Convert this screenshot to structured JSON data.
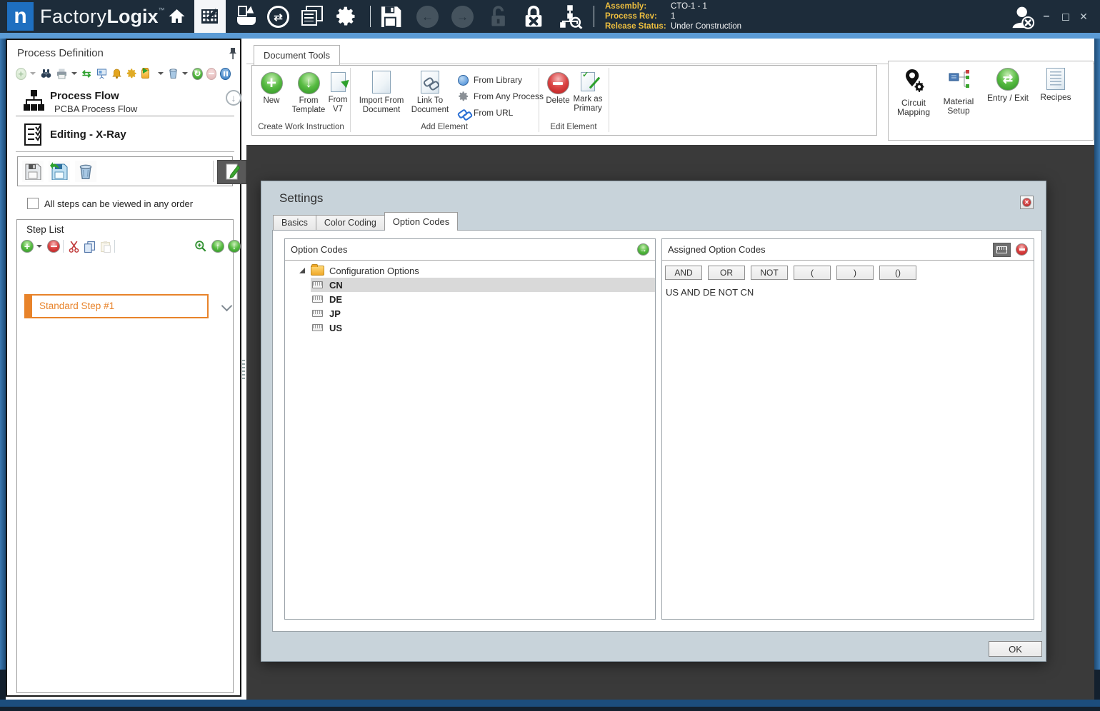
{
  "colors": {
    "accent_blue": "#5b9bd5",
    "titlebar_bg": "#1d2c3a",
    "logo_blue": "#1e6fc0",
    "highlight_orange": "#e8832a",
    "gold_label": "#eebf3f",
    "dialog_bg": "#c8d3da",
    "canvas_gray": "#3a3a3a",
    "selection_gray": "#d9d9d9",
    "action_green": "#3aa52f",
    "action_red": "#c21f1f"
  },
  "titlebar": {
    "logo_letter": "n",
    "brand_factory": "Factory",
    "brand_logix": "Logix",
    "trademark": "™",
    "info": {
      "assembly_label": "Assembly:",
      "assembly_value": "CTO-1 - 1",
      "process_rev_label": "Process Rev:",
      "process_rev_value": "1",
      "release_status_label": "Release Status:",
      "release_status_value": "Under Construction"
    },
    "window_controls": {
      "minimize": "–",
      "maximize": "◻",
      "close": "✕"
    }
  },
  "sidebar": {
    "title": "Process Definition",
    "process_flow": {
      "title": "Process Flow",
      "subtitle": "PCBA Process Flow"
    },
    "editing_title": "Editing - X-Ray",
    "order_checkbox_label": "All steps can be viewed in any order",
    "step_list": {
      "title": "Step List",
      "steps": [
        {
          "label": "Standard Step #1"
        }
      ]
    }
  },
  "ribbon": {
    "tab_label": "Document Tools",
    "groups": [
      {
        "label": "Create Work Instruction",
        "items": [
          {
            "label": "New"
          },
          {
            "label": "From Template"
          },
          {
            "label": "From V7"
          }
        ]
      },
      {
        "label": "Add Element",
        "items": [
          {
            "label": "Import From Document"
          },
          {
            "label": "Link To Document"
          }
        ],
        "menu_items": [
          {
            "label": "From Library"
          },
          {
            "label": "From Any Process"
          },
          {
            "label": "From URL"
          }
        ]
      },
      {
        "label": "Edit Element",
        "items": [
          {
            "label": "Delete"
          },
          {
            "label": "Mark as Primary"
          }
        ]
      }
    ],
    "tools": [
      {
        "label": "Circuit Mapping"
      },
      {
        "label": "Material Setup"
      },
      {
        "label": "Entry / Exit"
      },
      {
        "label": "Recipes"
      }
    ]
  },
  "dialog": {
    "title": "Settings",
    "tabs": [
      {
        "label": "Basics"
      },
      {
        "label": "Color Coding"
      },
      {
        "label": "Option Codes"
      }
    ],
    "option_codes": {
      "panel_title": "Option Codes",
      "root_label": "Configuration Options",
      "items": [
        {
          "label": "CN"
        },
        {
          "label": "DE"
        },
        {
          "label": "JP"
        },
        {
          "label": "US"
        }
      ],
      "selected": "CN"
    },
    "assigned": {
      "panel_title": "Assigned Option Codes",
      "operators": [
        "AND",
        "OR",
        "NOT",
        "(",
        ")",
        "()"
      ],
      "expression": "US AND DE NOT CN"
    },
    "ok_label": "OK"
  }
}
